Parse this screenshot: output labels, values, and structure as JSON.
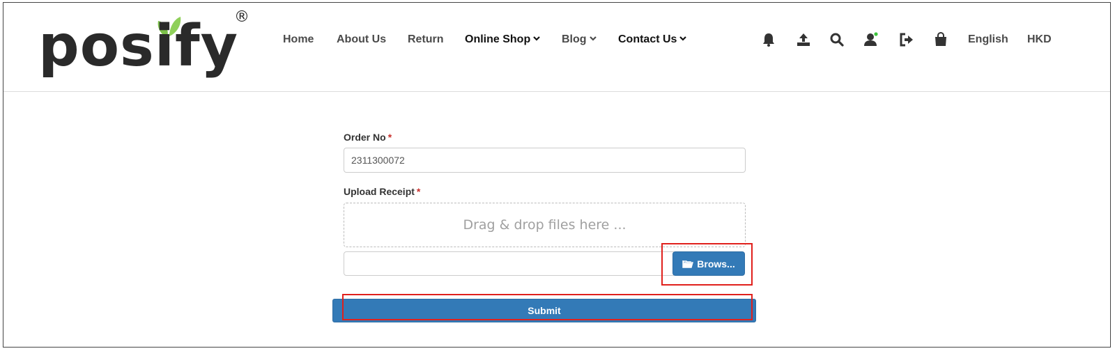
{
  "logo": {
    "text": "posify",
    "registered_mark": "®"
  },
  "nav": {
    "items": [
      {
        "label": "Home"
      },
      {
        "label": "About Us"
      },
      {
        "label": "Return"
      },
      {
        "label": "Online Shop"
      },
      {
        "label": "Blog"
      },
      {
        "label": "Contact Us"
      }
    ]
  },
  "utility": {
    "icons": [
      "bell-icon",
      "upload-icon",
      "search-icon",
      "user-icon",
      "logout-icon",
      "shopping-bag-icon"
    ],
    "language": "English",
    "currency": "HKD",
    "online_dot_color": "#3cc43c"
  },
  "form": {
    "order_no": {
      "label": "Order No",
      "required_mark": "*",
      "value": "2311300072"
    },
    "upload_receipt": {
      "label": "Upload Receipt",
      "required_mark": "*",
      "dropzone_text": "Drag & drop files here ...",
      "browse_label": "Brows..."
    },
    "submit_label": "Submit"
  },
  "colors": {
    "primary": "#337ab7",
    "highlight": "#e0201c",
    "required": "#c9302c",
    "leaf": "#7cc14a"
  }
}
